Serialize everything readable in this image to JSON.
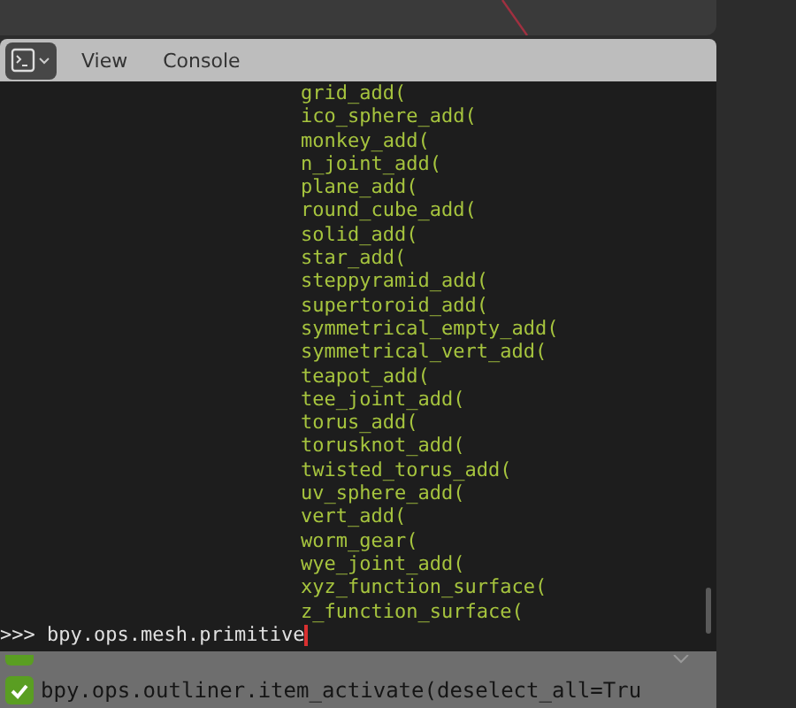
{
  "header": {
    "menus": [
      "View",
      "Console"
    ]
  },
  "console": {
    "completions": [
      "grid_add(",
      "ico_sphere_add(",
      "monkey_add(",
      "n_joint_add(",
      "plane_add(",
      "round_cube_add(",
      "solid_add(",
      "star_add(",
      "steppyramid_add(",
      "supertoroid_add(",
      "symmetrical_empty_add(",
      "symmetrical_vert_add(",
      "teapot_add(",
      "tee_joint_add(",
      "torus_add(",
      "torusknot_add(",
      "twisted_torus_add(",
      "uv_sphere_add(",
      "vert_add(",
      "worm_gear(",
      "wye_joint_add(",
      "xyz_function_surface(",
      "z_function_surface("
    ],
    "prompt": ">>>",
    "input": "bpy.ops.mesh.primitive"
  },
  "info": {
    "rows": [
      {
        "text": "bpy.ops.outliner.item_activate(deselect_all=Tru"
      }
    ]
  }
}
